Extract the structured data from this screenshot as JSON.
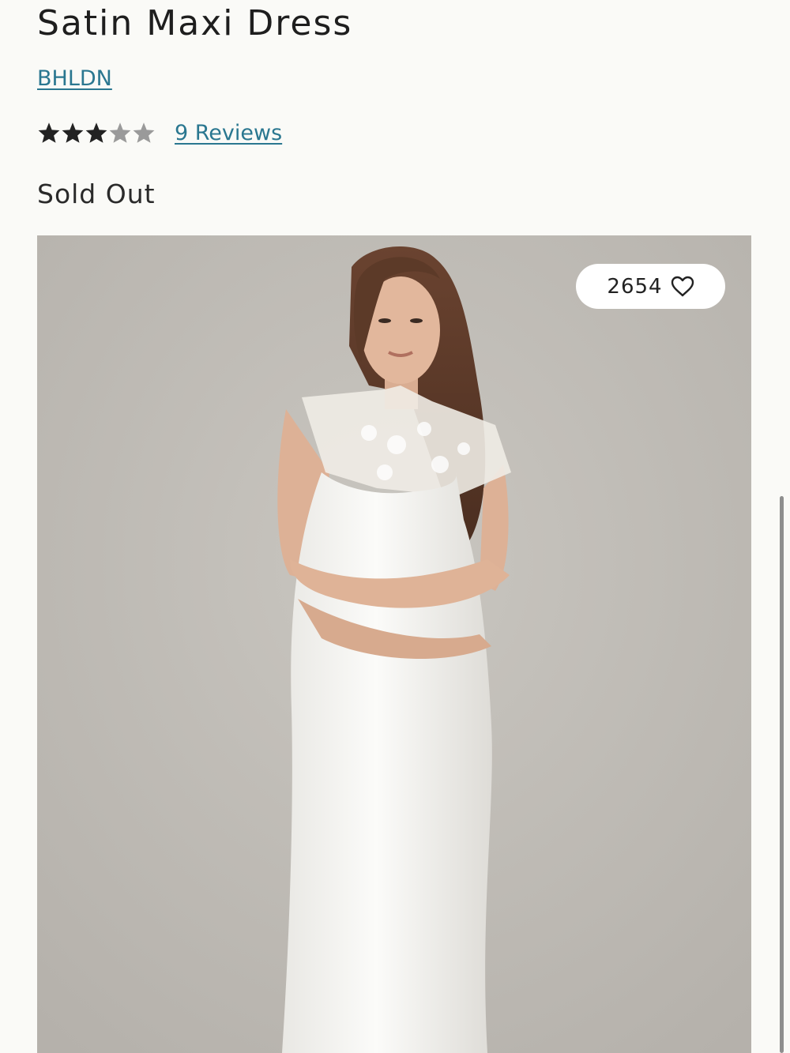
{
  "product": {
    "title": "Satin Maxi Dress",
    "brand": "BHLDN",
    "rating": 3,
    "rating_max": 5,
    "reviews_label": "9 Reviews",
    "status": "Sold Out"
  },
  "image": {
    "like_count": "2654"
  },
  "icons": {
    "star": "star-icon",
    "heart": "heart-outline-icon"
  },
  "colors": {
    "link": "#2a7790",
    "star_filled": "#222222",
    "star_empty": "#9a9a9a",
    "background": "#fafaf7"
  }
}
